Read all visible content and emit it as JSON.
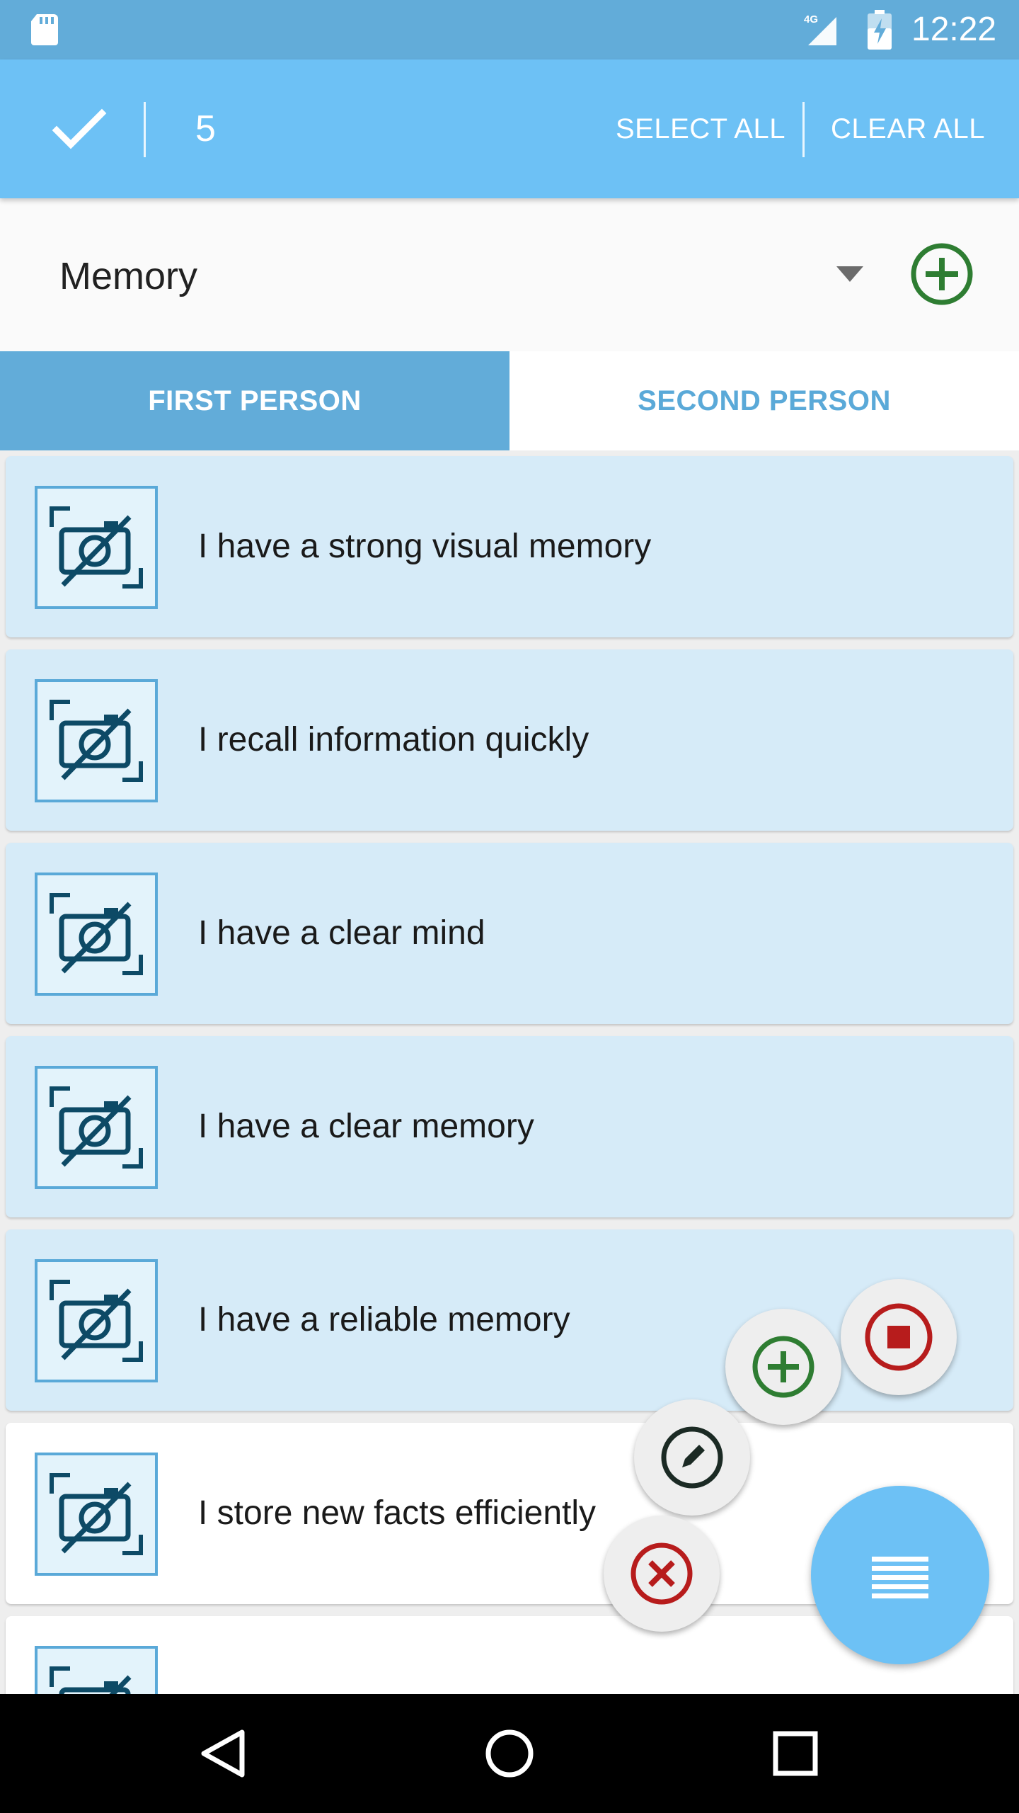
{
  "status_bar": {
    "network": "4G",
    "time": "12:22",
    "icons": [
      "sd-card-icon",
      "signal-icon",
      "battery-charging-icon"
    ]
  },
  "action_bar": {
    "selected_count": "5",
    "select_all_label": "SELECT ALL",
    "clear_all_label": "CLEAR ALL",
    "icons": [
      "check-icon"
    ]
  },
  "category": {
    "selected": "Memory",
    "icons": [
      "dropdown-arrow-icon",
      "add-circle-icon"
    ]
  },
  "tabs": [
    {
      "label": "FIRST PERSON",
      "active": true
    },
    {
      "label": "SECOND PERSON",
      "active": false
    }
  ],
  "items": [
    {
      "text": "I have a strong visual memory",
      "selected": true
    },
    {
      "text": "I recall information quickly",
      "selected": true
    },
    {
      "text": "I have a clear mind",
      "selected": true
    },
    {
      "text": "I have a clear memory",
      "selected": true
    },
    {
      "text": "I have a reliable memory",
      "selected": true
    },
    {
      "text": "I store new facts efficiently",
      "selected": false
    },
    {
      "text": "",
      "selected": false
    }
  ],
  "fab_actions": [
    "stop-icon",
    "add-icon",
    "edit-icon",
    "delete-icon",
    "menu-icon"
  ],
  "nav_bar": [
    "back-icon",
    "home-icon",
    "recents-icon"
  ],
  "colors": {
    "primary": "#6dc1f5",
    "primary_dark": "#62acd9",
    "selected_card": "#d6ebf8",
    "add_green": "#2e7d32",
    "delete_red": "#b71c1c"
  }
}
